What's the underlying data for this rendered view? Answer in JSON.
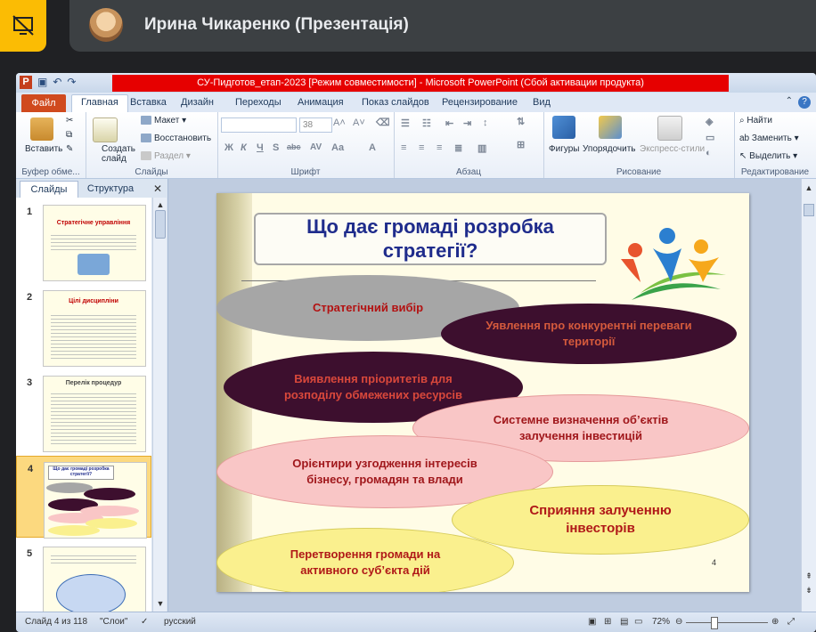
{
  "meet": {
    "participant_name": "Ирина Чикаренко (Презентація)",
    "icons": [
      "presentation-off-icon",
      "avatar"
    ]
  },
  "window": {
    "title": "СУ-Пидготов_етап-2023 [Режим совместимости] - Microsoft PowerPoint (Сбой активации продукта)"
  },
  "ribbon": {
    "tabs": [
      "Файл",
      "Главная",
      "Вставка",
      "Дизайн",
      "Переходы",
      "Анимация",
      "Показ слайдов",
      "Рецензирование",
      "Вид"
    ],
    "active_tab": "Главная",
    "clipboard": {
      "paste": "Вставить",
      "label": "Буфер обме..."
    },
    "slides": {
      "new_slide": "Создать слайд",
      "layout": "Макет",
      "reset": "Восстановить",
      "section": "Раздел",
      "label": "Слайды"
    },
    "font": {
      "size": "38",
      "label": "Шрифт"
    },
    "paragraph": {
      "label": "Абзац"
    },
    "drawing": {
      "shapes": "Фигуры",
      "arrange": "Упорядочить",
      "quick_styles": "Экспресс-стили",
      "label": "Рисование"
    },
    "editing": {
      "find": "Найти",
      "replace": "Заменить",
      "select": "Выделить",
      "label": "Редактирование"
    }
  },
  "left_pane": {
    "tabs": [
      "Слайды",
      "Структура"
    ],
    "thumbs": [
      {
        "num": "1",
        "title": "Стратегічне управління"
      },
      {
        "num": "2",
        "title": "Цілі дисципліни"
      },
      {
        "num": "3",
        "title": "Перелік процедур"
      },
      {
        "num": "4",
        "title": "Що дає громаді розробка стратегії?"
      },
      {
        "num": "5",
        "title": ""
      }
    ],
    "selected": "4"
  },
  "slide": {
    "title": "Що дає громаді розробка стратегії?",
    "page": "4",
    "ellipses": [
      "Стратегічний вибір",
      "Уявлення про конкурентні переваги території",
      "Виявлення пріоритетів для розподілу обмежених ресурсів",
      "Системне визначення об’єктів залучення інвестицій",
      "Орієнтири узгодження інтересів бізнесу, громадян та влади",
      "Сприяння залученню інвесторів",
      "Перетворення громади на активного суб’єкта дій"
    ]
  },
  "status": {
    "slide_info": "Слайд 4 из 118",
    "theme": "\"Слои\"",
    "language": "русский",
    "zoom": "72%"
  }
}
